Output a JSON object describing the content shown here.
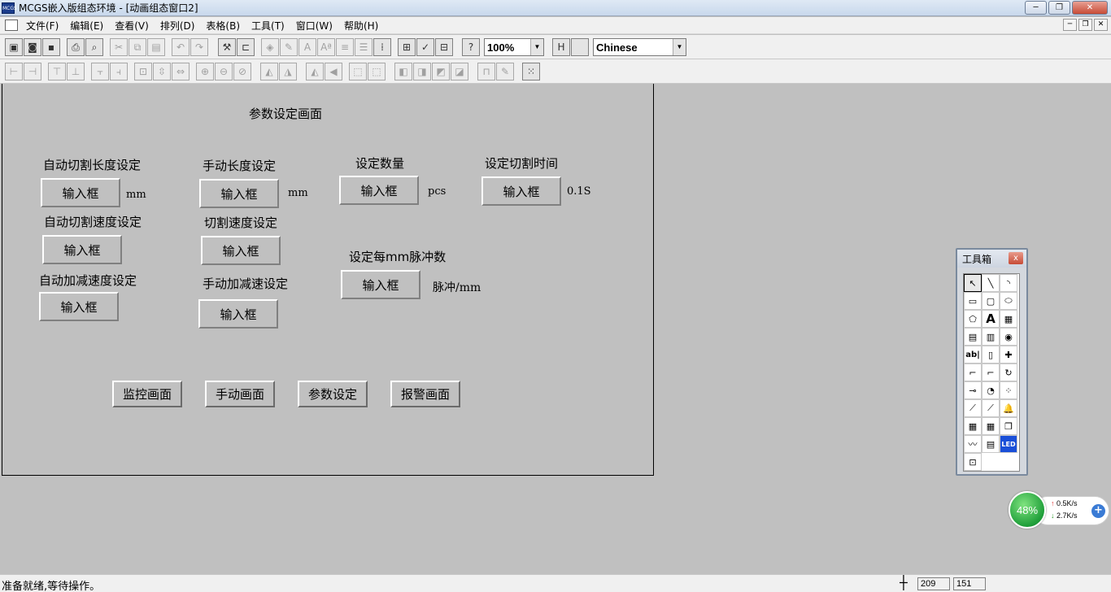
{
  "window": {
    "title": "MCGS嵌入版组态环境 - [动画组态窗口2]",
    "app_icon_label": "MCGS",
    "minimize": "─",
    "maximize": "❐",
    "close": "✕"
  },
  "menu": {
    "items": [
      "文件(F)",
      "编辑(E)",
      "查看(V)",
      "排列(D)",
      "表格(B)",
      "工具(T)",
      "窗口(W)",
      "帮助(H)"
    ],
    "mdi_minimize": "─",
    "mdi_restore": "❐",
    "mdi_close": "✕"
  },
  "toolbar": {
    "zoom": "100%",
    "language": "Chinese",
    "dropdown_arrow": "▼"
  },
  "screen": {
    "title": "参数设定画面",
    "fields": [
      {
        "label": "自动切割长度设定",
        "input": "输入框",
        "unit": "mm"
      },
      {
        "label": "手动长度设定",
        "input": "输入框",
        "unit": "mm"
      },
      {
        "label": "设定数量",
        "input": "输入框",
        "unit": "pcs"
      },
      {
        "label": "设定切割时间",
        "input": "输入框",
        "unit": "0.1S"
      },
      {
        "label": "自动切割速度设定",
        "input": "输入框"
      },
      {
        "label": "切割速度设定",
        "input": "输入框"
      },
      {
        "label": "设定每mm脉冲数",
        "input": "输入框",
        "unit": "脉冲/mm"
      },
      {
        "label": "自动加减速度设定",
        "input": "输入框"
      },
      {
        "label": "手动加减速设定",
        "input": "输入框"
      }
    ],
    "nav_buttons": [
      "监控画面",
      "手动画面",
      "参数设定",
      "报警画面"
    ]
  },
  "toolbox": {
    "title": "工具箱",
    "close": "x",
    "tools": [
      {
        "icon": "pointer-icon",
        "glyph": "↖"
      },
      {
        "icon": "line-icon",
        "glyph": "╲"
      },
      {
        "icon": "arc-icon",
        "glyph": "◝"
      },
      {
        "icon": "rectangle-icon",
        "glyph": "▭"
      },
      {
        "icon": "rounded-rect-icon",
        "glyph": "▢"
      },
      {
        "icon": "ellipse-icon",
        "glyph": "⬭"
      },
      {
        "icon": "polygon-icon",
        "glyph": "⬠"
      },
      {
        "icon": "text-icon",
        "glyph": "A"
      },
      {
        "icon": "bitmap-icon",
        "glyph": "▦"
      },
      {
        "icon": "flow-icon",
        "glyph": "▤"
      },
      {
        "icon": "element-icon",
        "glyph": "▥"
      },
      {
        "icon": "insert-element-icon",
        "glyph": "◉"
      },
      {
        "icon": "input-box-icon",
        "glyph": "ab|"
      },
      {
        "icon": "slider-icon",
        "glyph": "▯"
      },
      {
        "icon": "alarm-light-icon",
        "glyph": "✚"
      },
      {
        "icon": "standard-button-icon",
        "glyph": "⌐"
      },
      {
        "icon": "motion-button-icon",
        "glyph": "⌐"
      },
      {
        "icon": "rotation-icon",
        "glyph": "↻"
      },
      {
        "icon": "scale-icon",
        "glyph": "⊸"
      },
      {
        "icon": "gauge-icon",
        "glyph": "◔"
      },
      {
        "icon": "combo-icon",
        "glyph": "⁘"
      },
      {
        "icon": "trend-chart-icon",
        "glyph": "⟋"
      },
      {
        "icon": "history-curve-icon",
        "glyph": "⟋"
      },
      {
        "icon": "alarm-display-icon",
        "glyph": "🔔"
      },
      {
        "icon": "table-icon",
        "glyph": "▦"
      },
      {
        "icon": "history-table-icon",
        "glyph": "▦"
      },
      {
        "icon": "window-stack-icon",
        "glyph": "❐"
      },
      {
        "icon": "curve-icon",
        "glyph": "〰"
      },
      {
        "icon": "report-icon",
        "glyph": "▤"
      },
      {
        "icon": "led-icon",
        "glyph": "LED"
      },
      {
        "icon": "custom-window-icon",
        "glyph": "⊡"
      }
    ]
  },
  "network": {
    "percent": "48%",
    "up_arrow": "↑",
    "down_arrow": "↓",
    "up": "0.5K/s",
    "down": "2.7K/s",
    "plus": "+"
  },
  "status": {
    "text": "准备就绪,等待操作。",
    "crosshair": "┼",
    "x": "209",
    "y": "151"
  }
}
